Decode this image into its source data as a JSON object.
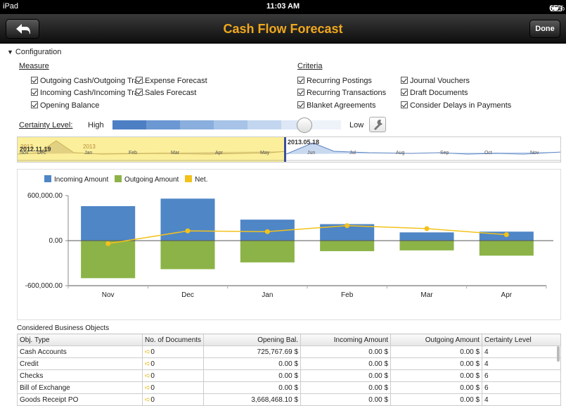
{
  "status": {
    "carrier": "iPad",
    "time": "11:03 AM",
    "battery": "65%"
  },
  "nav": {
    "title": "Cash Flow Forecast",
    "done": "Done"
  },
  "config": {
    "header": "Configuration",
    "measure_label": "Measure",
    "criteria_label": "Criteria",
    "measure": [
      "Outgoing Cash/Outgoing Tra...",
      "Expense Forecast",
      "Incoming Cash/Incoming Tra...",
      "Sales Forecast",
      "Opening Balance"
    ],
    "criteria": [
      "Recurring Postings",
      "Journal Vouchers",
      "Recurring Transactions",
      "Draft Documents",
      "Blanket Agreements",
      "Consider Delays in Payments"
    ],
    "certainty_label": "Certainty Level:",
    "certainty_high": "High",
    "certainty_low": "Low",
    "certainty_level": 0.83
  },
  "timeline": {
    "start_date": "2012.11.19",
    "end_date": "2013.05.18",
    "year_2012": "2012",
    "year_2013": "2013",
    "months": [
      "Nov",
      "Dec",
      "Jan",
      "Feb",
      "Mar",
      "Apr",
      "May",
      "Jun",
      "Jul",
      "Aug",
      "Sep",
      "Oct",
      "Nov"
    ]
  },
  "chart_data": {
    "type": "bar",
    "categories": [
      "Nov",
      "Dec",
      "Jan",
      "Feb",
      "Mar",
      "Apr"
    ],
    "series": [
      {
        "name": "Incoming Amount",
        "color": "#4f86c6",
        "values": [
          460000,
          560000,
          280000,
          220000,
          110000,
          120000
        ]
      },
      {
        "name": "Outgoing Amount",
        "color": "#8cb347",
        "values": [
          -500000,
          -380000,
          -290000,
          -140000,
          -130000,
          -200000
        ]
      },
      {
        "name": "Net.",
        "color": "#f2c21b",
        "type": "line",
        "values": [
          -40000,
          130000,
          120000,
          200000,
          160000,
          80000
        ]
      }
    ],
    "yticks": [
      "600,000.00",
      "0.00",
      "-600,000.00"
    ],
    "ylim": [
      -600000,
      600000
    ]
  },
  "table": {
    "title": "Considered Business Objects",
    "headers": [
      "Obj. Type",
      "No. of Documents",
      "Opening Bal.",
      "Incoming Amount",
      "Outgoing Amount",
      "Certainty Level"
    ],
    "rows": [
      [
        "Cash Accounts",
        "0",
        "725,767.69 $",
        "0.00 $",
        "0.00 $",
        "4"
      ],
      [
        "Credit",
        "0",
        "0.00 $",
        "0.00 $",
        "0.00 $",
        "4"
      ],
      [
        "Checks",
        "0",
        "0.00 $",
        "0.00 $",
        "0.00 $",
        "6"
      ],
      [
        "Bill of Exchange",
        "0",
        "0.00 $",
        "0.00 $",
        "0.00 $",
        "6"
      ],
      [
        "Goods Receipt PO",
        "0",
        "3,668,468.10 $",
        "0.00 $",
        "0.00 $",
        "4"
      ]
    ]
  }
}
